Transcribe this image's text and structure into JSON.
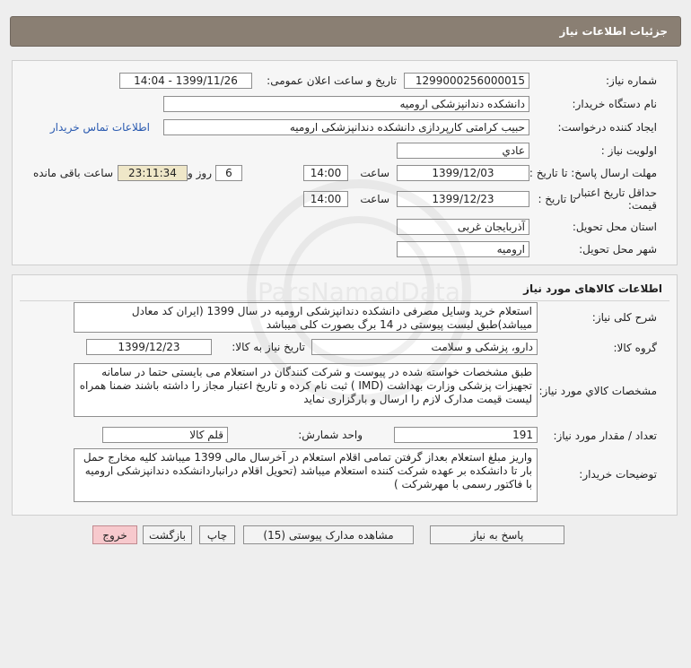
{
  "header": {
    "title": "جزئیات اطلاعات نیاز"
  },
  "need_info": {
    "need_number_label": "شماره نیاز:",
    "need_number": "1299000256000015",
    "announce_label": "تاریخ و ساعت اعلان عمومی:",
    "announce_value": "1399/11/26 - 14:04",
    "buyer_org_label": "نام دستگاه خریدار:",
    "buyer_org": "دانشکده دندانپزشکی ارومیه",
    "requester_label": "ایجاد کننده درخواست:",
    "requester": "حبیب کرامتی کارپردازی دانشکده دندانپزشکی ارومیه",
    "contact_link": "اطلاعات تماس خریدار",
    "priority_label": "اولویت نیاز :",
    "priority": "عادي",
    "deadline_label": "مهلت ارسال پاسخ: تا تاریخ :",
    "deadline_date": "1399/12/03",
    "time_label": "ساعت",
    "deadline_time": "14:00",
    "days_value": "6",
    "days_label": "روز و",
    "remaining_time": "23:11:34",
    "remaining_label": "ساعت باقی مانده",
    "validity_label_1": "حداقل تاریخ اعتبار",
    "validity_label_2": "قیمت:",
    "validity_to_label": "تا تاریخ :",
    "validity_date": "1399/12/23",
    "validity_time": "14:00",
    "province_label": "استان محل تحویل:",
    "province": "آذربایجان غربی",
    "city_label": "شهر محل تحویل:",
    "city": "ارومیه"
  },
  "goods": {
    "section_title": "اطلاعات کالاهای مورد نیاز",
    "general_desc_label": "شرح کلی نیاز:",
    "general_desc": "استعلام خرید وسایل مصرفی دانشکده دندانپزشکی ارومیه در سال 1399 (ایران کد معادل میباشد)طبق لیست پیوستی در 14 برگ  بصورت کلی میباشد",
    "group_label": "گروه کالا:",
    "group": "دارو، پزشکی و سلامت",
    "need_date_label": "تاریخ نیاز به کالا:",
    "need_date": "1399/12/23",
    "specs_label": "مشخصات کالاي مورد نياز:",
    "specs": "طبق مشخصات خواسته شده در پیوست و شرکت کنندگان در استعلام می بایستی حتما در سامانه تجهیزات پزشکی وزارت بهداشت (IMD ) ثبت نام کرده و تاریخ اعتبار مجاز را داشته باشند ضمنا همراه لیست قیمت مدارک لازم را ارسال و بارگزاری نماید",
    "qty_label": "تعداد / مقدار مورد نیاز:",
    "qty": "191",
    "unit_label": "واحد شمارش:",
    "unit": "قلم کالا",
    "buyer_notes_label": "توضیحات خریدار:",
    "buyer_notes": "واریز مبلغ استعلام بعداز گرفتن تمامی اقلام استعلام در آخرسال مالی 1399 میباشد کلیه مخارج حمل بار تا دانشکده بر عهده شرکت کننده استعلام میباشد (تحویل اقلام درانباردانشکده دندانپزشکی ارومیه با فاکتور رسمی با مهرشرکت )"
  },
  "actions": {
    "reply": "پاسخ به نیاز",
    "view_docs": "مشاهده مدارک پیوستی (15)",
    "print": "چاپ",
    "back": "بازگشت",
    "exit": "خروج"
  },
  "watermark": {
    "text": "ParsNamadData"
  }
}
